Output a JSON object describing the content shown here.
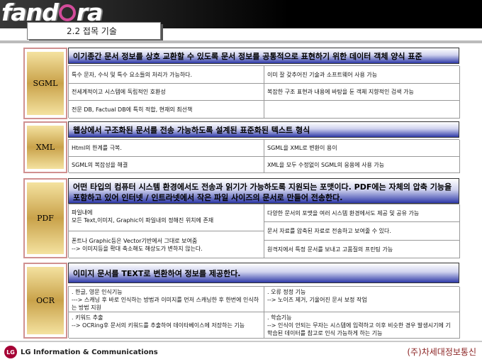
{
  "brand": {
    "logo_left": "fand",
    "logo_right": "ra"
  },
  "page_title": "2.2 접목 기술",
  "sections": [
    {
      "label": "SGML",
      "header": "이기종간 문서 정보를 상호 교환할 수 있도록 문서 정보를 공통적으로 표현하기 위한 데이터 객체 양식 표준",
      "cells": [
        "특수 문자, 수식 및 특수 요소들의 처리가 가능하다.",
        "이미 잘 갖추어진 기술과 소프트웨어 사용 가능",
        "전세계적이고 시스템에 독립적인 호환성",
        "복잡한 구조 표현과 내용에 바탕을 둔 객체 지향적인 검색 가능",
        "전문 DB, Factual DB에 특히 적합, 현재의 최선책",
        ""
      ]
    },
    {
      "label": "XML",
      "header": "웹상에서 구조화된 문서를 전송 가능하도록 설계된 표준화된 텍스트 형식",
      "cells": [
        "Html의 한계를 극복.",
        "SGML을 XML로 변환이 용이",
        "SGML의 복잡성을 해결",
        "XML을 모두 수정없이 SGML의 응용에 사용 가능"
      ]
    },
    {
      "label": "PDF",
      "header": "어떤 타입의 컴퓨터 시스템 환경에서도 전송과 읽기가 가능하도록 지원되는 포맷이다. PDF에는 자체의 압축 기능을 포함하고 있어 인터넷 / 인트라넷에서 작은 파일 사이즈의 문서로 만들어 전송한다.",
      "cells": [
        "파일내에\n모든 Text,이미지, Graphic이 파일내의 정해진 위치에 존재",
        "다양한 문서의 포맷을 여러 시스템 환경에서도 제공 및 공유 가능",
        "폰트나 Graphic등은 Vector기반에서 그대로 보여줌\n--> 이미지등을 확대 축소해도 해상도가 변하지 않는다.",
        "문서 자료를 압축된 자료로 전송하고 보여줄 수 있다.",
        "원격지에서 특정 문서를 보내고 고품질의 프린팅 가능"
      ]
    },
    {
      "label": "OCR",
      "header": "이미지 문서를 TEXT로 변환하여 정보를 제공한다.",
      "cells": [
        ". 한글, 영문 인식기능\n---> 스캐닝 후 바로 인식하는 방법과 이미지를 먼저 스캐닝한 후 한번에 인식하는 방법 지원",
        ". 오류 정정 기능\n--> 노이즈 제거, 기울어진 문서 보정 작업",
        ". 키워드 추출\n--> OCRing후 문서의 키워드를 추출하여 데이타베이스에 저장하는 기능",
        ". 학습기능\n--> 인식이 안되는 무자는 시스템에 입력하고 이후 비슷한 경우 발생시기에 기 학습된 데이터를 참고로 인식 가능하게 하는 기능"
      ]
    }
  ],
  "footer": {
    "lg_text": "LG Information & Communications",
    "company": "(주)차세대정보통신"
  }
}
